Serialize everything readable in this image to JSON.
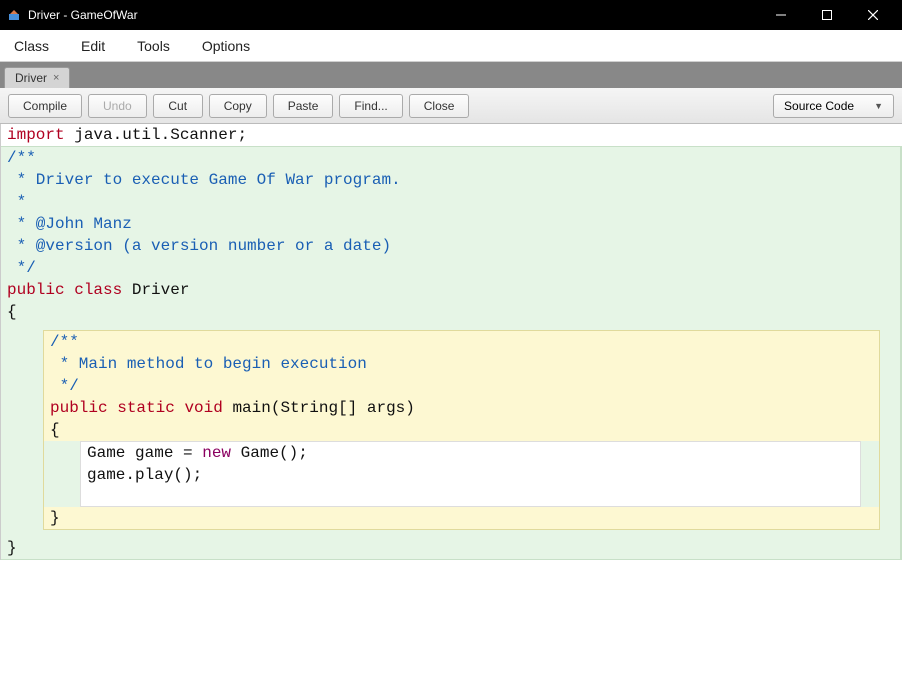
{
  "window": {
    "title": "Driver - GameOfWar"
  },
  "menubar": {
    "class": "Class",
    "edit": "Edit",
    "tools": "Tools",
    "options": "Options"
  },
  "tab": {
    "label": "Driver",
    "close": "×"
  },
  "toolbar": {
    "compile": "Compile",
    "undo": "Undo",
    "cut": "Cut",
    "copy": "Copy",
    "paste": "Paste",
    "find": "Find...",
    "close": "Close",
    "sourcecode": "Source Code"
  },
  "code": {
    "line1_a": "import",
    "line1_b": " java.util.Scanner;",
    "c1": "/**",
    "c2": " * Driver to execute Game Of War program.",
    "c3": " *",
    "c4": " * @John Manz",
    "c5": " * @version (a version number or a date)",
    "c6": " */",
    "pub": "public",
    "cls": "class",
    "drv": " Driver",
    "ob": "{",
    "cb": "}",
    "mc1": "/**",
    "mc2": " * Main method to begin execution",
    "mc3": " */",
    "mpub": "public",
    "mstat": "static",
    "mvoid": "void",
    "msig": " main(String[] args)",
    "mob": "{",
    "mcb": "}",
    "body1a": "Game game = ",
    "body1b": "new",
    "body1c": " Game();",
    "body2": "game.play();"
  }
}
